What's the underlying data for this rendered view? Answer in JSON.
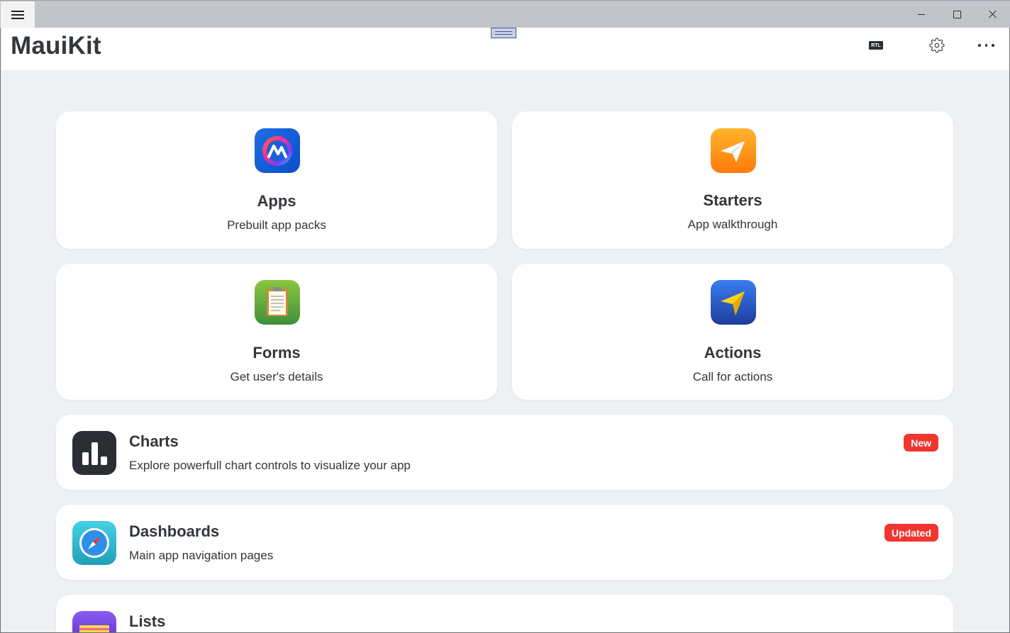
{
  "window": {
    "minimize_icon": "minimize-icon",
    "maximize_icon": "maximize-icon",
    "close_icon": "close-icon"
  },
  "header": {
    "title": "MauiKit",
    "rtl_label": "RTL",
    "settings_icon": "gear-icon",
    "more_icon": "more-horizontal-icon"
  },
  "tiles": [
    {
      "title": "Apps",
      "subtitle": "Prebuilt app packs",
      "icon": "apps-logo-icon"
    },
    {
      "title": "Starters",
      "subtitle": "App walkthrough",
      "icon": "paper-plane-icon"
    },
    {
      "title": "Forms",
      "subtitle": "Get user's details",
      "icon": "clipboard-icon"
    },
    {
      "title": "Actions",
      "subtitle": "Call for actions",
      "icon": "navigation-arrow-icon"
    }
  ],
  "rows": [
    {
      "title": "Charts",
      "subtitle": "Explore powerfull chart controls to visualize your app",
      "badge": "New",
      "icon": "bar-chart-icon"
    },
    {
      "title": "Dashboards",
      "subtitle": "Main app navigation pages",
      "badge": "Updated",
      "icon": "compass-icon"
    },
    {
      "title": "Lists",
      "subtitle": "",
      "badge": "",
      "icon": "list-icon"
    }
  ],
  "colors": {
    "badge": "#f0352f",
    "background": "#eef1f4",
    "card": "#ffffff"
  }
}
